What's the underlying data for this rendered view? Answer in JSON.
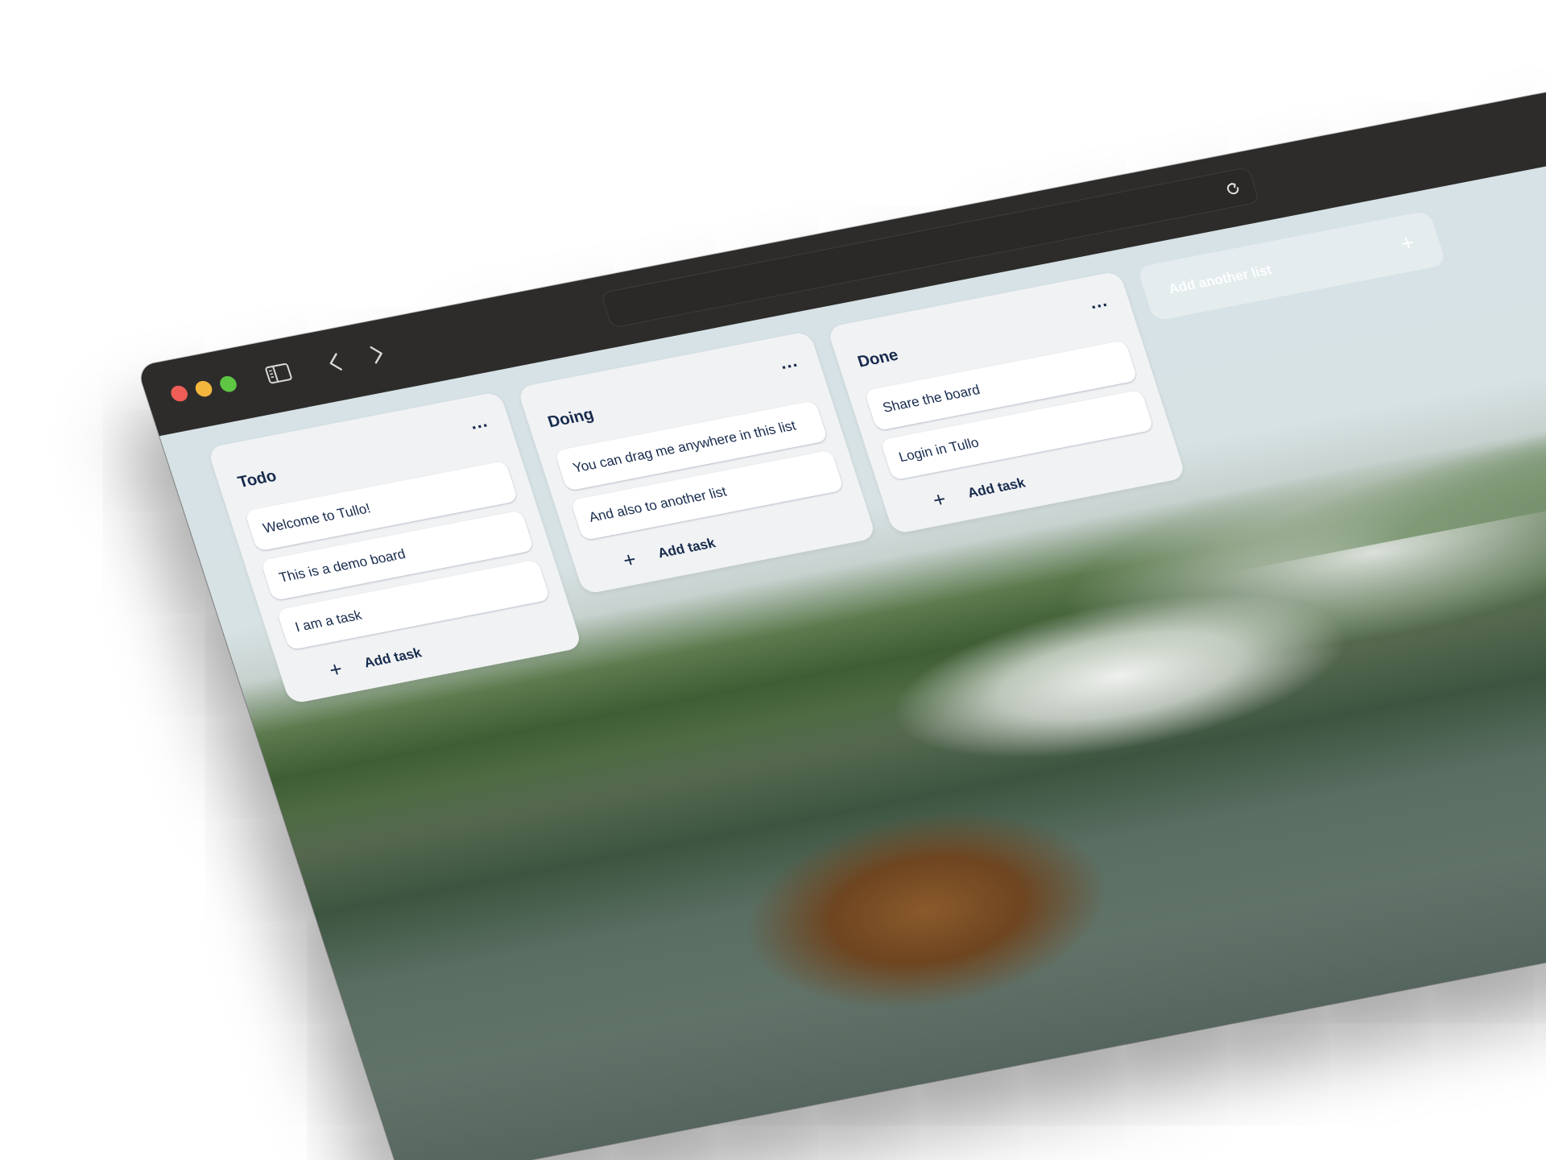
{
  "window": {
    "traffic_lights": {
      "close": "#ee5e57",
      "minimize": "#f4b73d",
      "maximize": "#5fc644"
    },
    "toolbar_icons": [
      "sidebar-icon",
      "chevron-left-icon",
      "chevron-right-icon",
      "reload-icon"
    ],
    "address": ""
  },
  "board": {
    "lists": [
      {
        "title": "Todo",
        "menu": "...",
        "cards": [
          "Welcome to Tullo!",
          "This is a demo board",
          "I am a task"
        ],
        "add_label": "Add task"
      },
      {
        "title": "Doing",
        "menu": "...",
        "cards": [
          "You can drag me anywhere in this list",
          "And also to another list"
        ],
        "add_label": "Add task"
      },
      {
        "title": "Done",
        "menu": "...",
        "cards": [
          "Share the board",
          "Login in Tullo"
        ],
        "add_label": "Add task"
      }
    ],
    "add_list_label": "Add another list",
    "add_icon": "+"
  },
  "colors": {
    "list_bg": "#f1f2f4",
    "card_bg": "#ffffff",
    "text": "#172b4d"
  }
}
